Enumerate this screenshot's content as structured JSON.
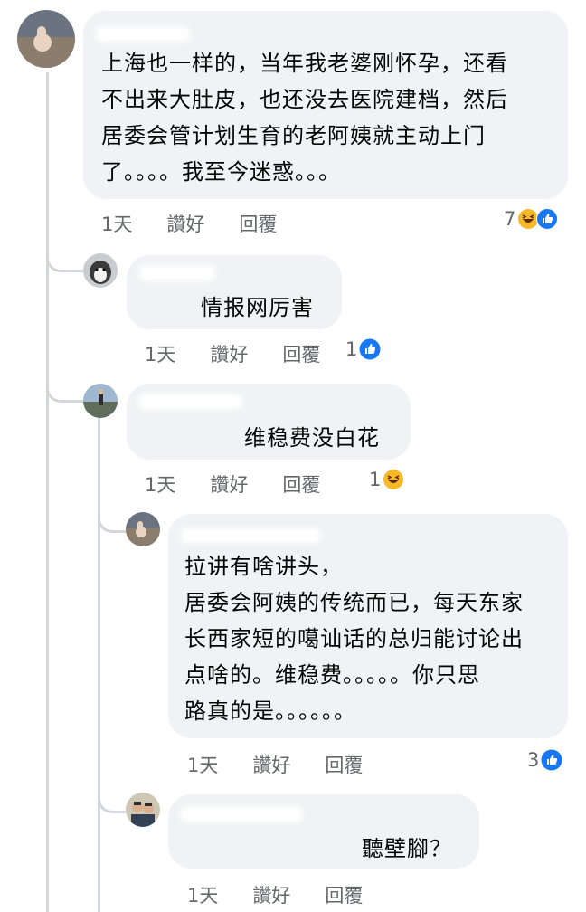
{
  "comments": [
    {
      "text": "上海也一样的，当年我老婆刚怀孕，还看\n不出来大肚皮，也还没去医院建档，然后\n居委会管计划生育的老阿姨就主动上门\n了。。。。我至今迷惑。。。",
      "time": "1天",
      "like": "讚好",
      "reply": "回覆",
      "reaction_count": "7",
      "reactions": [
        "haha-icon",
        "like-icon"
      ]
    },
    {
      "text": "情报网厉害",
      "time": "1天",
      "like": "讚好",
      "reply": "回覆",
      "reaction_count": "1",
      "reactions": [
        "like-icon"
      ]
    },
    {
      "text": "维稳费没白花",
      "time": "1天",
      "like": "讚好",
      "reply": "回覆",
      "reaction_count": "1",
      "reactions": [
        "haha-icon"
      ]
    },
    {
      "text": "拉讲有啥讲头，\n居委会阿姨的传统而已，每天东家\n长西家短的噶讪话的总归能讨论出\n点啥的。维稳费。。。。。你只思\n路真的是。。。。。。",
      "time": "1天",
      "like": "讚好",
      "reply": "回覆",
      "reaction_count": "3",
      "reactions": [
        "like-icon"
      ]
    },
    {
      "text": "聽壁腳？",
      "time": "1天",
      "like": "讚好",
      "reply": "回覆",
      "reaction_count": "",
      "reactions": []
    }
  ],
  "colors": {
    "bubble": "#f0f2f5",
    "like_blue": "#1877f2",
    "haha_yellow": "#f7b928",
    "meta_gray": "#65676b"
  }
}
